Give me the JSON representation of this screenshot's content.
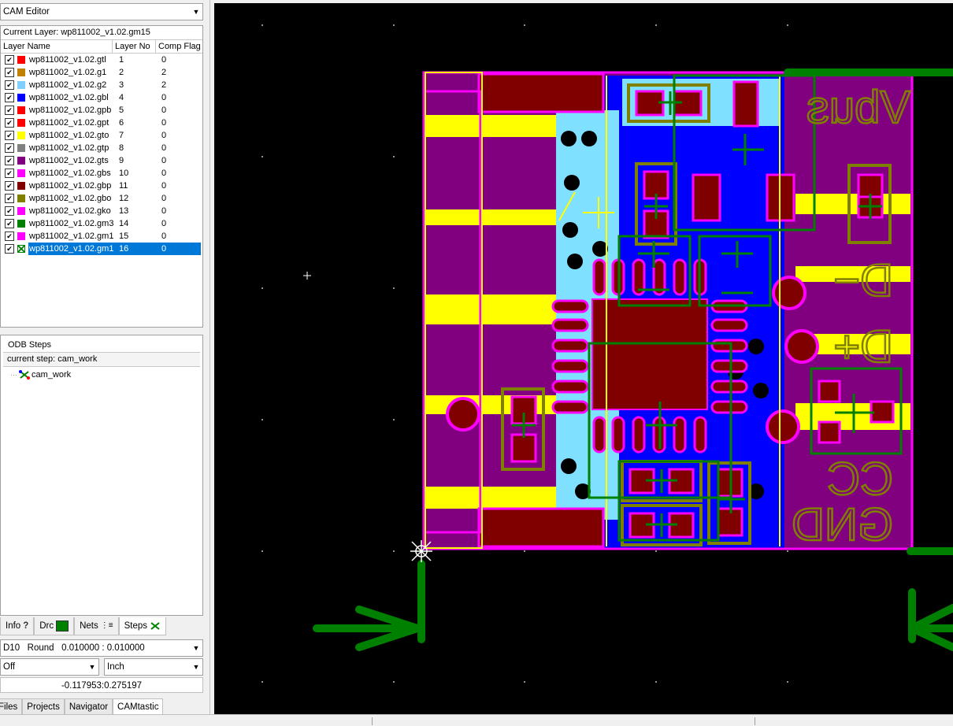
{
  "editor_select": {
    "value": "CAM Editor"
  },
  "current_layer": "Current Layer: wp811002_v1.02.gm15",
  "columns": {
    "name": "Layer Name",
    "no": "Layer No",
    "flag": "Comp Flag"
  },
  "layers": [
    {
      "name": "wp811002_v1.02.gtl",
      "no": "1",
      "flag": "0",
      "color": "#ff0000"
    },
    {
      "name": "wp811002_v1.02.g1",
      "no": "2",
      "flag": "2",
      "color": "#c08000"
    },
    {
      "name": "wp811002_v1.02.g2",
      "no": "3",
      "flag": "2",
      "color": "#80d0ff"
    },
    {
      "name": "wp811002_v1.02.gbl",
      "no": "4",
      "flag": "0",
      "color": "#0000ff"
    },
    {
      "name": "wp811002_v1.02.gpb",
      "no": "5",
      "flag": "0",
      "color": "#ff0000"
    },
    {
      "name": "wp811002_v1.02.gpt",
      "no": "6",
      "flag": "0",
      "color": "#ff0000"
    },
    {
      "name": "wp811002_v1.02.gto",
      "no": "7",
      "flag": "0",
      "color": "#ffff00"
    },
    {
      "name": "wp811002_v1.02.gtp",
      "no": "8",
      "flag": "0",
      "color": "#808080"
    },
    {
      "name": "wp811002_v1.02.gts",
      "no": "9",
      "flag": "0",
      "color": "#800080"
    },
    {
      "name": "wp811002_v1.02.gbs",
      "no": "10",
      "flag": "0",
      "color": "#ff00ff"
    },
    {
      "name": "wp811002_v1.02.gbp",
      "no": "11",
      "flag": "0",
      "color": "#800000"
    },
    {
      "name": "wp811002_v1.02.gbo",
      "no": "12",
      "flag": "0",
      "color": "#808000"
    },
    {
      "name": "wp811002_v1.02.gko",
      "no": "13",
      "flag": "0",
      "color": "#ff00ff"
    },
    {
      "name": "wp811002_v1.02.gm3",
      "no": "14",
      "flag": "0",
      "color": "#008000"
    },
    {
      "name": "wp811002_v1.02.gm1",
      "no": "15",
      "flag": "0",
      "color": "#ff00ff"
    },
    {
      "name": "wp811002_v1.02.gm1",
      "no": "16",
      "flag": "0",
      "color": "#008000",
      "selected": true
    }
  ],
  "steps": {
    "title": "ODB Steps",
    "current": "current step: cam_work",
    "item": "cam_work"
  },
  "tabs": [
    "Info",
    "Drc",
    "Nets",
    "Steps"
  ],
  "aperture_select": {
    "value": "D10   Round   0.010000 : 0.010000"
  },
  "snap_select": {
    "value": "Off"
  },
  "units_select": {
    "value": "Inch"
  },
  "coords": "-0.117953:0.275197",
  "bottom_tabs": [
    "Files",
    "Projects",
    "Navigator",
    "CAMtastic"
  ],
  "pcb_text": {
    "vbus": "Vbus",
    "dminus": "D−",
    "dplus": "D+",
    "cc": "CC",
    "gnd": "GND"
  },
  "colors": {
    "board_purple": "#800080",
    "copper_yellow": "#ffff00",
    "outline_magenta": "#ff00ff",
    "mech_green": "#007800",
    "pad_maroon": "#800000",
    "blue_fill": "#0000ff",
    "cyan_fill": "#80e0ff"
  }
}
